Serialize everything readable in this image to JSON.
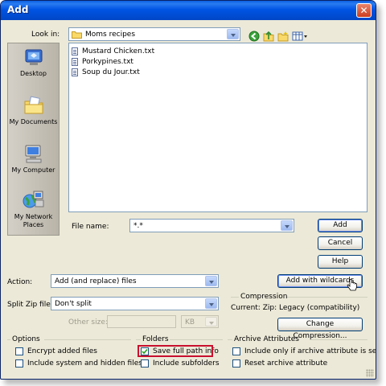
{
  "window": {
    "title": "Add",
    "close_glyph": "✕"
  },
  "look_in": {
    "label": "Look in:",
    "value": "Moms recipes"
  },
  "toolbar_icons": [
    "back-icon",
    "up-folder-icon",
    "new-folder-icon",
    "views-menu-icon"
  ],
  "places": [
    {
      "label": "Desktop",
      "icon": "desktop-icon"
    },
    {
      "label": "My Documents",
      "icon": "my-documents-icon"
    },
    {
      "label": "My Computer",
      "icon": "my-computer-icon"
    },
    {
      "label": "My Network Places",
      "icon": "network-places-icon"
    }
  ],
  "files": [
    {
      "name": "Mustard Chicken.txt"
    },
    {
      "name": "Porkypines.txt"
    },
    {
      "name": "Soup du Jour.txt"
    }
  ],
  "file_name": {
    "label": "File name:",
    "value": "*.*"
  },
  "buttons": {
    "add": "Add",
    "cancel": "Cancel",
    "help": "Help",
    "add_wildcards": "Add with wildcards",
    "change_compression": "Change Compression..."
  },
  "action": {
    "label": "Action:",
    "value": "Add (and replace) files"
  },
  "split_zip": {
    "label": "Split Zip file:",
    "value": "Don't split"
  },
  "other_size": {
    "label": "Other size:",
    "unit": "KB"
  },
  "compression": {
    "title": "Compression",
    "current": "Current: Zip: Legacy (compatibility)"
  },
  "options": {
    "title": "Options",
    "encrypt": {
      "label": "Encrypt added files",
      "checked": false
    },
    "include_system": {
      "label": "Include system and hidden files",
      "checked": false
    }
  },
  "folders": {
    "title": "Folders",
    "save_full_path": {
      "label": "Save full path info",
      "checked": true
    },
    "include_subfolders": {
      "label": "Include subfolders",
      "checked": false
    }
  },
  "archive_attributes": {
    "title": "Archive Attributes",
    "include_only_if": {
      "label": "Include only if archive attribute is set",
      "checked": false
    },
    "reset_attribute": {
      "label": "Reset archive attribute",
      "checked": false
    }
  },
  "colors": {
    "titlebar": "#0054e3",
    "dialog_bg": "#ece9d8",
    "highlight_box": "#c8102e"
  }
}
